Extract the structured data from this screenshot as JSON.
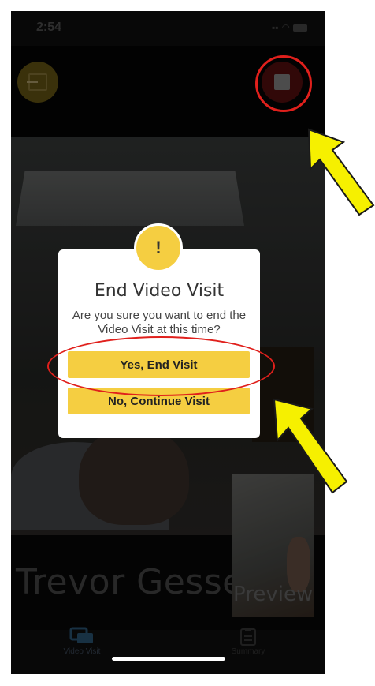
{
  "status_bar": {
    "time": "2:54",
    "signal_icon": "signal-bars-icon",
    "wifi_icon": "wifi-icon",
    "battery_icon": "battery-icon"
  },
  "toolbar": {
    "exit_icon": "exit-door-icon",
    "stop_icon": "stop-square-icon"
  },
  "video": {
    "participant_name": "Trevor Gessel",
    "preview_label": "Preview"
  },
  "dialog": {
    "alert_glyph": "!",
    "title": "End Video Visit",
    "message": "Are you sure you want to end the Video Visit at this time?",
    "confirm_label": "Yes, End Visit",
    "cancel_label": "No, Continue Visit"
  },
  "tabs": [
    {
      "label": "Video Visit",
      "icon": "chat-bubbles-icon"
    },
    {
      "label": "Summary",
      "icon": "clipboard-icon"
    }
  ],
  "annotations": {
    "highlight_color": "#e0201c",
    "arrow_color": "#f6f000"
  },
  "colors": {
    "accent": "#f5ce41",
    "stop": "#5a0f10"
  }
}
